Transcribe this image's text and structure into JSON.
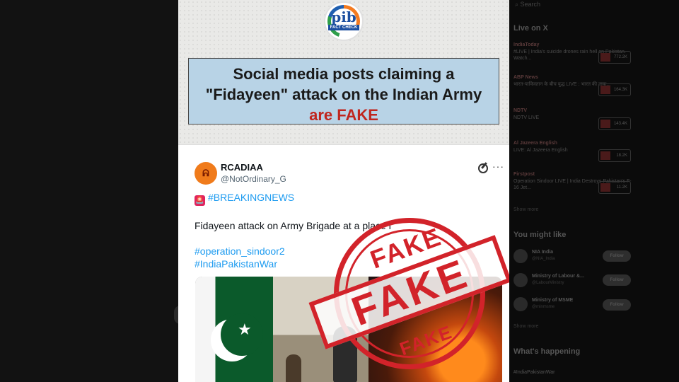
{
  "card": {
    "logo": {
      "brand": "pib",
      "tag": "FACT CHECK"
    },
    "headline": {
      "line1": "Social media posts claiming a",
      "line2": "\"Fidayeen\" attack on the Indian Army",
      "line3": "are FAKE"
    },
    "colors": {
      "headline_bg": "#b8d3e6",
      "fake_red": "#c0261e",
      "stamp_red": "#d2232a"
    }
  },
  "tweet": {
    "display_name": "RCADIAA",
    "handle": "@NotOrdinary_G",
    "hashtag_breaking": "#BREAKINGNEWS",
    "body": "Fidayeen attack on Army Brigade at a place i",
    "tags": [
      "#operation_sindoor2",
      "#IndiaPakistanWar"
    ],
    "icons": {
      "avatar": "avatar",
      "grok": "grok-icon",
      "more": "more-icon",
      "siren": "siren-icon"
    }
  },
  "stamp": {
    "top_word": "FAKE",
    "center_word": "FAKE",
    "bottom_word": "FAKE"
  },
  "sidebar": {
    "search": "Search",
    "live_heading": "Live on X",
    "live_items": [
      {
        "source": "IndiaToday",
        "title": "#LIVE | India's suicide drones rain hell on Pakistan. Watch...",
        "count": "772.2K"
      },
      {
        "source": "ABP News",
        "title": "भारत-पाकिस्तान के बीच युद्ध LIVE : भारत की ताक...",
        "count": "164.3K"
      },
      {
        "source": "NDTV",
        "title": "NDTV LIVE",
        "count": "143.4K"
      },
      {
        "source": "Al Jazeera English",
        "title": "LIVE: Al Jazeera English",
        "count": "18.2K"
      },
      {
        "source": "Firstpost",
        "title": "Operation Sindoor LIVE | India Destroys Pakistan's F-16 Jet...",
        "count": "11.2K"
      }
    ],
    "show_more": "Show more",
    "might_like_heading": "You might like",
    "might_like": [
      {
        "name": "NIA India",
        "handle": "@NIA_India",
        "button": "Follow"
      },
      {
        "name": "Ministry of Labour &...",
        "handle": "@LabourMinistry",
        "button": "Follow"
      },
      {
        "name": "Ministry of MSME",
        "handle": "@minmsme",
        "button": "Follow"
      }
    ],
    "show_more_2": "Show more",
    "whats_happening_heading": "What's happening",
    "trend": "#IndiaPakistanWar"
  }
}
